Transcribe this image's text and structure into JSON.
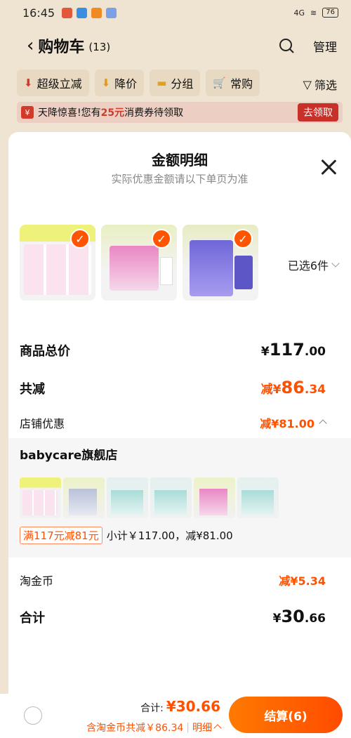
{
  "status_bar": {
    "time": "16:45",
    "network": "4G",
    "battery": "76"
  },
  "header": {
    "title": "购物车",
    "count": "(13)",
    "manage": "管理"
  },
  "filters": [
    {
      "label": "超级立减",
      "icon": "arrow-down-red-icon"
    },
    {
      "label": "降价",
      "icon": "arrow-down-orange-icon"
    },
    {
      "label": "分组",
      "icon": "folder-icon"
    },
    {
      "label": "常购",
      "icon": "cart-icon"
    }
  ],
  "filter_right": "筛选",
  "coupon_bar": {
    "prefix": "天降惊喜!您有",
    "amount": "25元",
    "suffix": "消费券待领取",
    "button": "去领取"
  },
  "sheet": {
    "title": "金额明细",
    "subtitle": "实际优惠金额请以下单页为准",
    "selected": "已选6件",
    "goods_total": {
      "label": "商品总价",
      "value_prefix": "¥",
      "value_int": "117",
      "value_dec": ".00"
    },
    "total_reduce": {
      "label": "共减",
      "value_prefix": "减¥",
      "value_int": "86",
      "value_dec": ".34"
    },
    "shop_discount": {
      "label": "店铺优惠",
      "value": "减¥81.00"
    },
    "shop": {
      "name": "babycare旗舰店",
      "promo_tag": "满117元减81元",
      "subtotal_text": "小计￥117.00，减¥81.00"
    },
    "coins": {
      "label": "淘金币",
      "value": "减¥5.34"
    },
    "sum": {
      "label": "合计",
      "value_prefix": "¥",
      "value_int": "30",
      "value_dec": ".66"
    }
  },
  "footer": {
    "total_label": "合计:",
    "total_value": "¥30.66",
    "detail_text": "含淘金币共减￥86.34",
    "detail_button": "明细",
    "checkout": "结算(6)"
  },
  "colors": {
    "accent": "#ff5000",
    "check": "#ff5500",
    "coupon_red": "#c8302a"
  }
}
